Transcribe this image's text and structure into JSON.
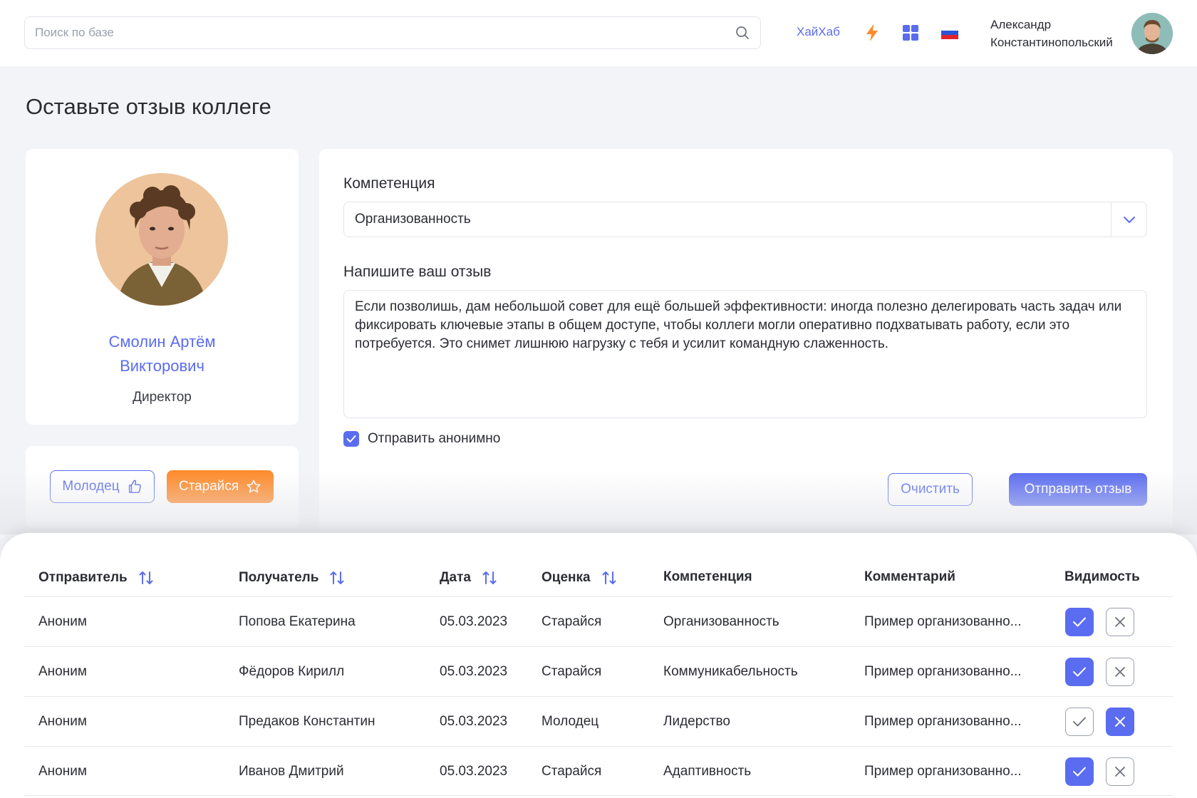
{
  "header": {
    "search_placeholder": "Поиск по базе",
    "hub_link": "ХайХаб",
    "user_name_line1": "Александр",
    "user_name_line2": "Константинопольский",
    "icons": [
      "search-icon",
      "lightning-icon",
      "grid-icon",
      "russia-flag-icon"
    ]
  },
  "page": {
    "title": "Оставьте отзыв коллеге"
  },
  "profile": {
    "name_line1": "Смолин Артём",
    "name_line2": "Викторович",
    "role": "Директор"
  },
  "praise": {
    "good_label": "Молодец",
    "try_label": "Старайся"
  },
  "form": {
    "competence_label": "Компетенция",
    "competence_value": "Организованность",
    "review_label": "Напишите ваш отзыв",
    "review_text": "Если позволишь, дам небольшой совет для ещё большей эффективности: иногда полезно делегировать часть задач или фиксировать ключевые этапы в общем доступе, чтобы коллеги могли оперативно подхватывать работу, если это потребуется. Это снимет лишнюю нагрузку с тебя и усилит командную слаженность.",
    "anonymous_label": "Отправить анонимно",
    "anonymous_checked": true,
    "clear_label": "Очистить",
    "submit_label": "Отправить отзыв"
  },
  "table": {
    "headers": {
      "sender": "Отправитель",
      "recipient": "Получатель",
      "date": "Дата",
      "rating": "Оценка",
      "competence": "Компетенция",
      "comment": "Комментарий",
      "visibility": "Видимость"
    },
    "rows": [
      {
        "sender": "Аноним",
        "recipient": "Попова Екатерина",
        "date": "05.03.2023",
        "rating": "Старайся",
        "competence": "Организованность",
        "comment": "Пример организованно...",
        "visible": true
      },
      {
        "sender": "Аноним",
        "recipient": "Фёдоров Кирилл",
        "date": "05.03.2023",
        "rating": "Старайся",
        "competence": "Коммуникабельность",
        "comment": "Пример организованно...",
        "visible": true
      },
      {
        "sender": "Аноним",
        "recipient": "Предаков Константин",
        "date": "05.03.2023",
        "rating": "Молодец",
        "competence": "Лидерство",
        "comment": "Пример организованно...",
        "visible": false
      },
      {
        "sender": "Аноним",
        "recipient": "Иванов Дмитрий",
        "date": "05.03.2023",
        "rating": "Старайся",
        "competence": "Адаптивность",
        "comment": "Пример организованно...",
        "visible": true
      }
    ]
  },
  "colors": {
    "accent": "#5a6cf0",
    "orange": "#ff8a2a",
    "background": "#f3f4f8"
  }
}
